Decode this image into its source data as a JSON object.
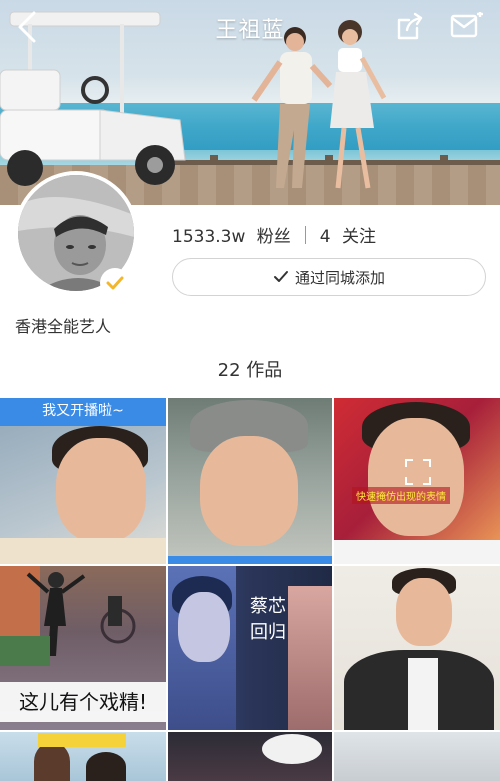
{
  "header": {
    "title": "王祖蓝"
  },
  "profile": {
    "followers_count": "1533.3w",
    "followers_label": "粉丝",
    "following_count": "4",
    "following_label": "关注",
    "add_button_label": "通过同城添加",
    "bio": "香港全能艺人"
  },
  "works": {
    "count_text": "22 作品",
    "items": [
      {
        "overlay": "我又开播啦~"
      },
      {
        "overlay": ""
      },
      {
        "overlay": "快速掩仿出现的表情"
      },
      {
        "overlay": "这儿有个戏精!"
      },
      {
        "overlay": "蔡芯回归"
      },
      {
        "overlay": ""
      }
    ]
  },
  "icons": {
    "back": "chevron-left-icon",
    "share": "share-icon",
    "mail": "mail-icon",
    "verified": "verified-check-icon"
  },
  "colors": {
    "accent_blue": "#3a8be6",
    "verified_gold": "#f3b72b",
    "text": "#333333"
  }
}
